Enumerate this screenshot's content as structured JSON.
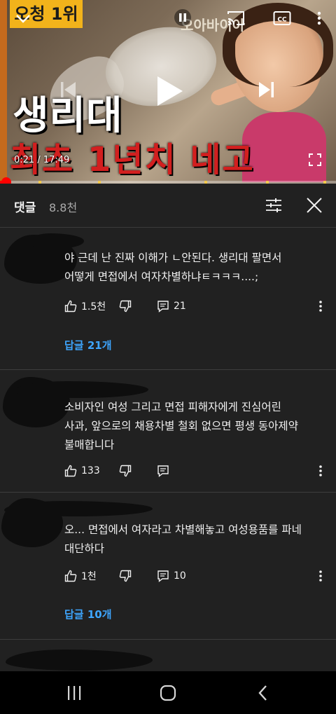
{
  "video": {
    "badge": "오청 1위",
    "watermark": "오아바이아",
    "title_line1": "생리대",
    "title_line2": "최초 1년치 네고",
    "time": "0:21 / 17:49",
    "progress": 0.0195
  },
  "comments_panel": {
    "title": "댓글",
    "count": "8.8천"
  },
  "comments": [
    {
      "text": "야 근데 난 진짜 이해가 ㄴ안된다. 생리대 팔면서\n어떻게 면접에서 여자차별하냐ㅌㅋㅋㅋ....;",
      "likes": "1.5천",
      "reply_count": "21",
      "replies_label": "답글 21개"
    },
    {
      "text": "소비자인 여성 그리고 면접 피해자에게 진심어린\n사과, 앞으로의 채용차별 철회 없으면 평생 동아제약\n불매합니다",
      "likes": "133",
      "reply_count": "",
      "replies_label": ""
    },
    {
      "text": "오... 면접에서 여자라고 차별해놓고 여성용품를 파네\n대단하다",
      "likes": "1천",
      "reply_count": "10",
      "replies_label": "답글 10개"
    }
  ],
  "icons": {
    "top_bar": [
      "chevron-down-icon",
      "pause-icon",
      "cast-icon",
      "closed-captions-icon",
      "more-vert-icon"
    ],
    "player_center": [
      "previous-icon",
      "play-icon",
      "next-icon"
    ],
    "player_bottom": [
      "fullscreen-icon"
    ],
    "comments_header": [
      "sort-filter-icon",
      "close-icon"
    ],
    "comment_actions": [
      "thumbs-up-icon",
      "thumbs-down-icon",
      "reply-icon",
      "more-vert-icon"
    ],
    "system_nav": [
      "recent-apps-icon",
      "home-icon",
      "back-icon"
    ]
  },
  "colors": {
    "background": "#212121",
    "accent_link": "#3ea6ff",
    "progress": "#ff0000",
    "text": "#f1f1f1",
    "secondary_text": "#aaaaaa"
  }
}
